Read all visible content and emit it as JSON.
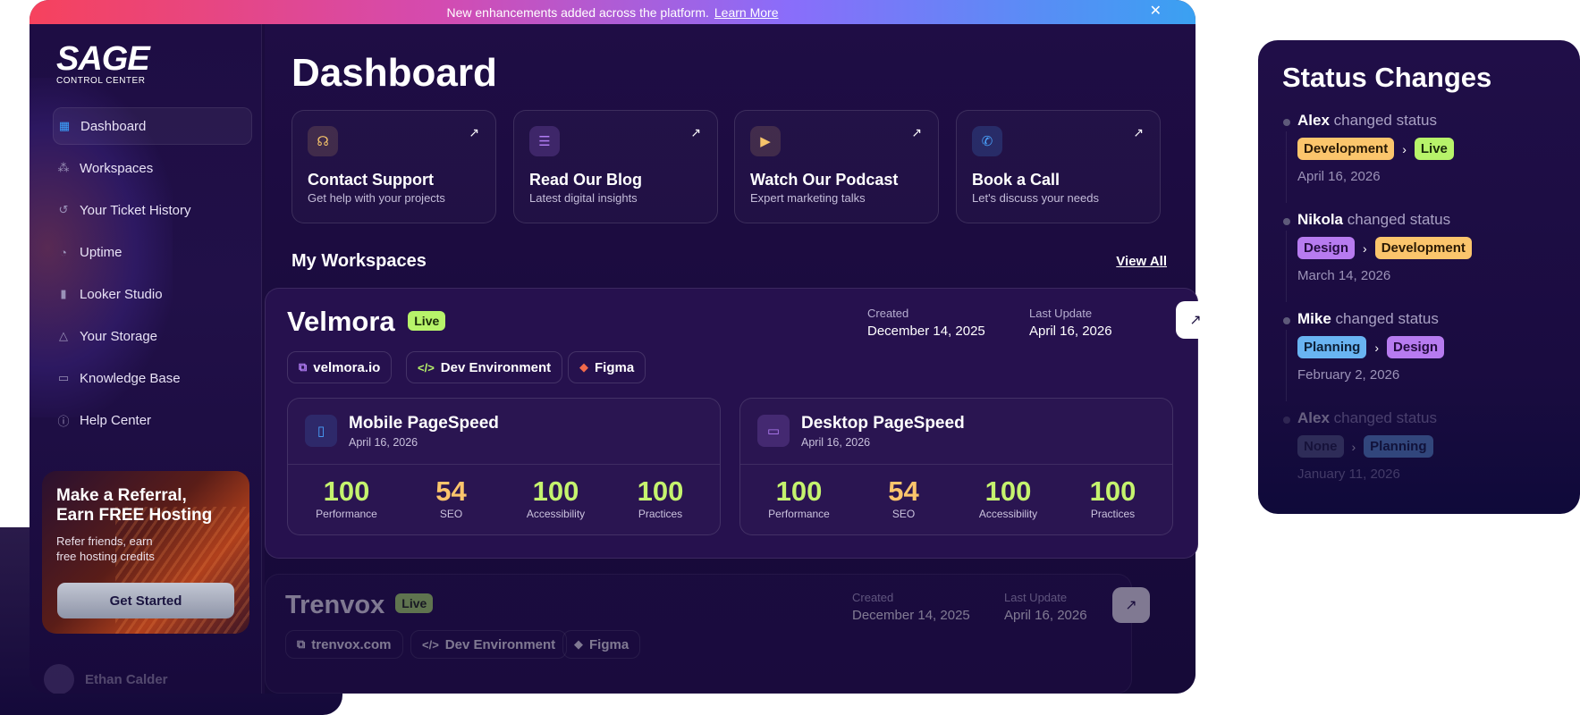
{
  "banner": {
    "text": "New enhancements added across the platform.",
    "link": "Learn More"
  },
  "brand": {
    "name": "SAGE",
    "sub": "CONTROL CENTER"
  },
  "sidebar": {
    "items": [
      {
        "label": "Dashboard",
        "icon": "grid-icon"
      },
      {
        "label": "Workspaces",
        "icon": "nodes-icon"
      },
      {
        "label": "Your Ticket History",
        "icon": "history-icon"
      },
      {
        "label": "Uptime",
        "icon": "pie-icon"
      },
      {
        "label": "Looker Studio",
        "icon": "bar-chart-icon"
      },
      {
        "label": "Your Storage",
        "icon": "drive-icon"
      },
      {
        "label": "Knowledge Base",
        "icon": "book-icon"
      },
      {
        "label": "Help Center",
        "icon": "info-icon"
      }
    ]
  },
  "promo": {
    "title_line1": "Make a Referral,",
    "title_line2": "Earn FREE Hosting",
    "text": "Refer friends, earn free hosting credits",
    "button": "Get Started"
  },
  "user": {
    "name": "Ethan Calder"
  },
  "main": {
    "title": "Dashboard",
    "section": "My Workspaces",
    "view_all": "View All"
  },
  "quick": [
    {
      "title": "Contact Support",
      "sub": "Get help with your projects",
      "icon": "headset-icon",
      "color": "#f6c46a"
    },
    {
      "title": "Read Our Blog",
      "sub": "Latest digital insights",
      "icon": "list-icon",
      "color": "#b07cf3"
    },
    {
      "title": "Watch Our Podcast",
      "sub": "Expert marketing talks",
      "icon": "play-icon",
      "color": "#f6c46a"
    },
    {
      "title": "Book a Call",
      "sub": "Let's discuss your needs",
      "icon": "phone-icon",
      "color": "#4aa4ff"
    }
  ],
  "workspaces": [
    {
      "name": "Velmora",
      "status": "Live",
      "created_label": "Created",
      "created": "December 14, 2025",
      "updated_label": "Last Update",
      "updated": "April 16, 2026",
      "chips": [
        "velmora.io",
        "Dev Environment",
        "Figma"
      ],
      "pagespeed": [
        {
          "title": "Mobile PageSpeed",
          "date": "April 16, 2026",
          "scores": [
            {
              "v": "100",
              "l": "Performance"
            },
            {
              "v": "54",
              "l": "SEO"
            },
            {
              "v": "100",
              "l": "Accessibility"
            },
            {
              "v": "100",
              "l": "Practices"
            }
          ]
        },
        {
          "title": "Desktop PageSpeed",
          "date": "April 16, 2026",
          "scores": [
            {
              "v": "100",
              "l": "Performance"
            },
            {
              "v": "54",
              "l": "SEO"
            },
            {
              "v": "100",
              "l": "Accessibility"
            },
            {
              "v": "100",
              "l": "Practices"
            }
          ]
        }
      ]
    },
    {
      "name": "Trenvox",
      "status": "Live",
      "created_label": "Created",
      "created": "December 14, 2025",
      "updated_label": "Last Update",
      "updated": "April 16, 2026",
      "chips": [
        "trenvox.com",
        "Dev Environment",
        "Figma"
      ]
    }
  ],
  "status_changes": {
    "title": "Status Changes",
    "verb": "changed status",
    "items": [
      {
        "user": "Alex",
        "from": "Development",
        "to": "Live",
        "date": "April 16, 2026"
      },
      {
        "user": "Nikola",
        "from": "Design",
        "to": "Development",
        "date": "March 14, 2026"
      },
      {
        "user": "Mike",
        "from": "Planning",
        "to": "Design",
        "date": "February 2, 2026"
      },
      {
        "user": "Alex",
        "from": "None",
        "to": "Planning",
        "date": "January 11, 2026"
      }
    ]
  }
}
